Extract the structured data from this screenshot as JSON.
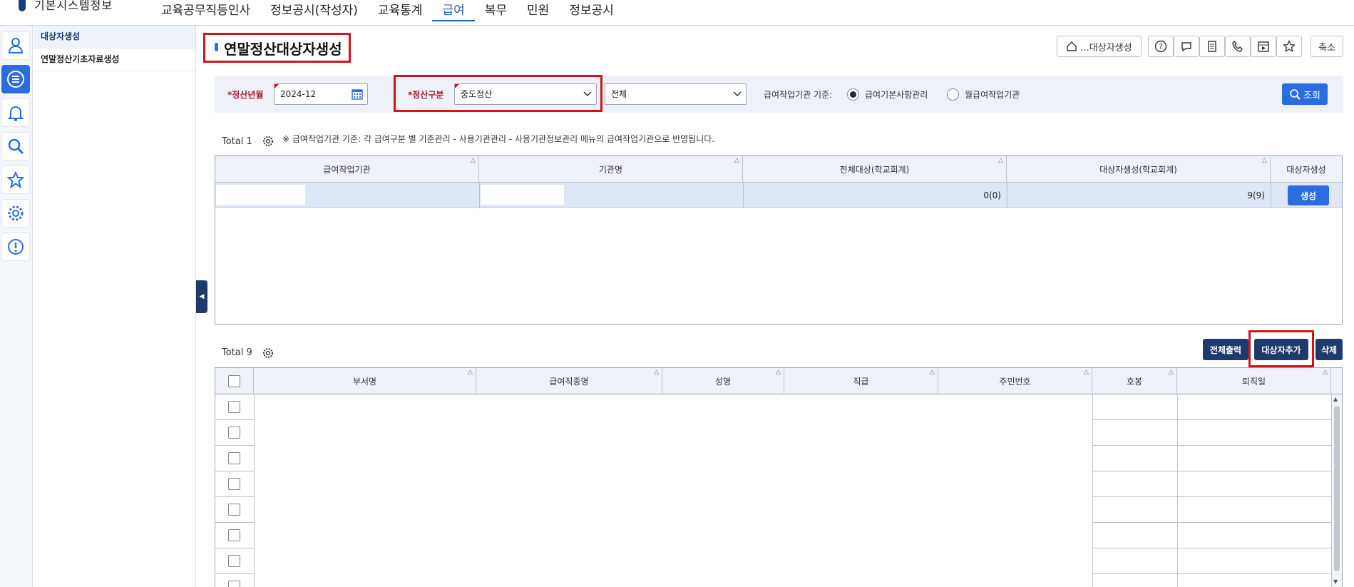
{
  "app": {
    "logo_text": "기본시스템정보"
  },
  "topnav": {
    "items": [
      {
        "label": "교육공무직등인사"
      },
      {
        "label": "정보공시(작성자)"
      },
      {
        "label": "교육통계"
      },
      {
        "label": "급여"
      },
      {
        "label": "복무"
      },
      {
        "label": "민원"
      },
      {
        "label": "정보공시"
      }
    ],
    "active": "급여"
  },
  "rail": {
    "icons": [
      "user-icon",
      "list-icon",
      "bell-icon",
      "search-icon",
      "star-icon",
      "gear-icon",
      "alert-icon"
    ],
    "active": "list-icon"
  },
  "submenu": {
    "items": [
      {
        "label": "대상자생성"
      },
      {
        "label": "연말정산기초자료생성"
      }
    ]
  },
  "page": {
    "title": "연말정산대상자생성",
    "breadcrumb_button": "...대상자생성",
    "shrink_button": "축소",
    "toolbar_icons": [
      "help-icon",
      "chat-icon",
      "document-icon",
      "phone-icon",
      "calendar-icon",
      "star-icon"
    ]
  },
  "search": {
    "year_month": {
      "label": "*정산년월",
      "value": "2024-12"
    },
    "gubun": {
      "label": "*정산구분",
      "value": "중도정산"
    },
    "scope": {
      "value": "전체"
    },
    "basis": {
      "label": "급여작업기관 기준:",
      "options": [
        {
          "label": "급여기본사항관리",
          "checked": true
        },
        {
          "label": "월급여작업기관",
          "checked": false
        }
      ]
    },
    "button": "조회"
  },
  "grid1": {
    "total": "Total 1",
    "note": "※ 급여작업기관 기준: 각 급여구분 별 기준관리 - 사용기관관리 - 사용기관정보관리 메뉴의 급여작업기관으로 반영됩니다.",
    "columns": [
      "급여작업기관",
      "기관명",
      "전체대상(학교회계)",
      "대상자생성(학교회계)",
      "대상자생성"
    ],
    "rows": [
      {
        "agency": "",
        "name": "",
        "total": "0(0)",
        "created": "9(9)",
        "action": "생성"
      }
    ]
  },
  "grid2": {
    "total": "Total 9",
    "buttons": {
      "print_all": "전체출력",
      "add_target": "대상자추가",
      "delete": "삭제"
    },
    "columns": [
      "부서명",
      "급여직종명",
      "성명",
      "직급",
      "주민번호",
      "호봉",
      "퇴직일"
    ]
  }
}
